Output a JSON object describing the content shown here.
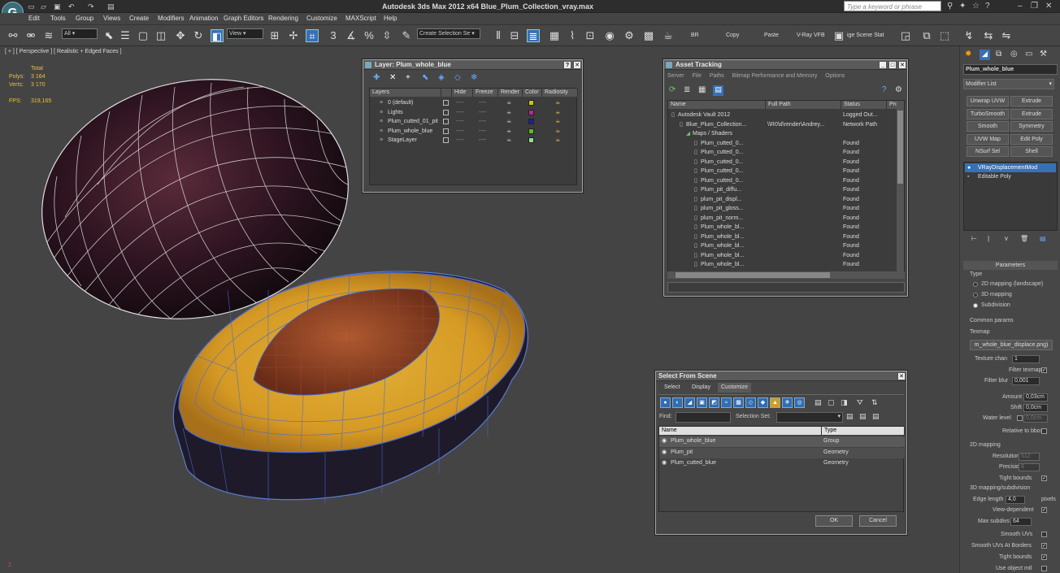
{
  "app": {
    "title": "Autodesk 3ds Max  2012 x64     Blue_Plum_Collection_vray.max",
    "logo_text": "G",
    "search_placeholder": "Type a keyword or phrase"
  },
  "menu": [
    "Edit",
    "Tools",
    "Group",
    "Views",
    "Create",
    "Modifiers",
    "Animation",
    "Graph Editors",
    "Rendering",
    "Customize",
    "MAXScript",
    "Help"
  ],
  "toolbar": {
    "filter_select": "All",
    "refcoord_select": "View",
    "selection_set": "Create Selection Se",
    "labels": [
      "BR",
      "Copy",
      "Paste",
      "V-Ray VFB",
      "ige Scene Stat"
    ]
  },
  "viewport": {
    "label": "[ + ] [ Perspective ] [ Realistic + Edged Faces ]",
    "stats": {
      "total_label": "Total",
      "polys_label": "Polys:",
      "polys": "3 164",
      "verts_label": "Verts:",
      "verts": "3 170",
      "fps_label": "FPS:",
      "fps": "319,165"
    }
  },
  "layer_dialog": {
    "title": "Layer: Plum_whole_blue",
    "columns": [
      "Layers",
      "Hide",
      "Freeze",
      "Render",
      "Color",
      "Radiosity"
    ],
    "rows": [
      {
        "name": "0 (default)",
        "color": "#c8c800"
      },
      {
        "name": "Lights",
        "color": "#c81e9a"
      },
      {
        "name": "Plum_cutted_01_pit",
        "color": "#1e1ea0"
      },
      {
        "name": "Plum_whole_blue",
        "color": "#6ab41e"
      },
      {
        "name": "StageLayer",
        "color": "#90e090"
      }
    ],
    "dash": "----"
  },
  "asset_tracking": {
    "title": "Asset Tracking",
    "menu": [
      "Server",
      "File",
      "Paths",
      "Bitmap Performance and Memory",
      "Options"
    ],
    "columns": [
      "Name",
      "Full Path",
      "Status",
      "Pro"
    ],
    "rows": [
      {
        "name": "Autodesk Vault 2012",
        "path": "",
        "status": "Logged Out..."
      },
      {
        "name": "Blue_Plum_Collection...",
        "path": "\\\\R0\\d\\render\\Andrey...",
        "status": "Network Path"
      },
      {
        "name": "Maps / Shaders",
        "path": "",
        "status": ""
      },
      {
        "name": "Plum_cutted_0...",
        "path": "",
        "status": "Found"
      },
      {
        "name": "Plum_cutted_0...",
        "path": "",
        "status": "Found"
      },
      {
        "name": "Plum_cutted_0...",
        "path": "",
        "status": "Found"
      },
      {
        "name": "Plum_cutted_0...",
        "path": "",
        "status": "Found"
      },
      {
        "name": "Plum_cutted_0...",
        "path": "",
        "status": "Found"
      },
      {
        "name": "Plum_pit_diffu...",
        "path": "",
        "status": "Found"
      },
      {
        "name": "plum_pit_displ...",
        "path": "",
        "status": "Found"
      },
      {
        "name": "plum_pit_gloss...",
        "path": "",
        "status": "Found"
      },
      {
        "name": "plum_pit_norm...",
        "path": "",
        "status": "Found"
      },
      {
        "name": "Plum_whole_bl...",
        "path": "",
        "status": "Found"
      },
      {
        "name": "Plum_whole_bl...",
        "path": "",
        "status": "Found"
      },
      {
        "name": "Plum_whole_bl...",
        "path": "",
        "status": "Found"
      },
      {
        "name": "Plum_whole_bl...",
        "path": "",
        "status": "Found"
      },
      {
        "name": "Plum_whole_bl...",
        "path": "",
        "status": "Found"
      }
    ]
  },
  "select_dialog": {
    "title": "Select From Scene",
    "tabs": [
      "Select",
      "Display",
      "Customize"
    ],
    "find_label": "Find:",
    "selection_set_label": "Selection Set:",
    "columns": [
      "Name",
      "Type"
    ],
    "rows": [
      {
        "name": "Plum_whole_blue",
        "type": "Group"
      },
      {
        "name": "Plum_pit",
        "type": "Geometry"
      },
      {
        "name": "Plum_cutted_blue",
        "type": "Geometry"
      }
    ],
    "ok": "OK",
    "cancel": "Cancel"
  },
  "command_panel": {
    "object_name": "Plum_whole_blue",
    "modifier_list": "Modifier List",
    "buttons": [
      "Unwrap UVW",
      "Extrude",
      "TurboSmooth",
      "Extrude",
      "Smooth",
      "Symmetry",
      "UVW Map",
      "Edit Poly",
      "NSurf Sel",
      "Shell"
    ],
    "stack": [
      "VRayDisplacementMod",
      "Editable Poly"
    ],
    "rollout_title": "Parameters",
    "type_label": "Type",
    "type_options": [
      "2D mapping (landscape)",
      "3D mapping",
      "Subdivision"
    ],
    "common_label": "Common params",
    "texmap_label": "Texmap",
    "texmap_value": "m_whole_blue_displace.png)",
    "texture_chan_label": "Texture chan",
    "texture_chan": "1",
    "filter_texmap": "Filter texmap",
    "filter_blur_label": "Filter blur",
    "filter_blur": "0,001",
    "amount_label": "Amount",
    "amount": "0,03cm",
    "shift_label": "Shift",
    "shift": "0,0cm",
    "water_label": "Water level",
    "water": "0,0cm",
    "relative_bbox": "Relative to bbox",
    "mapping2d_label": "2D mapping",
    "resolution_label": "Resolution",
    "resolution": "512",
    "precision_label": "Precision",
    "precision": "8",
    "tight_bounds": "Tight bounds",
    "mapping3d_label": "3D mapping/subdivision",
    "edge_len_label": "Edge length",
    "edge_len": "4,0",
    "pixels_label": "pixels",
    "view_dep": "View-dependent",
    "max_subdivs_label": "Max subdivs",
    "max_subdivs": "64",
    "smooth_uvs": "Smooth UVs",
    "smooth_uvs_borders": "Smooth UVs At Borders",
    "tight_bounds2": "Tight bounds",
    "use_object_mtl": "Use object mtl"
  }
}
